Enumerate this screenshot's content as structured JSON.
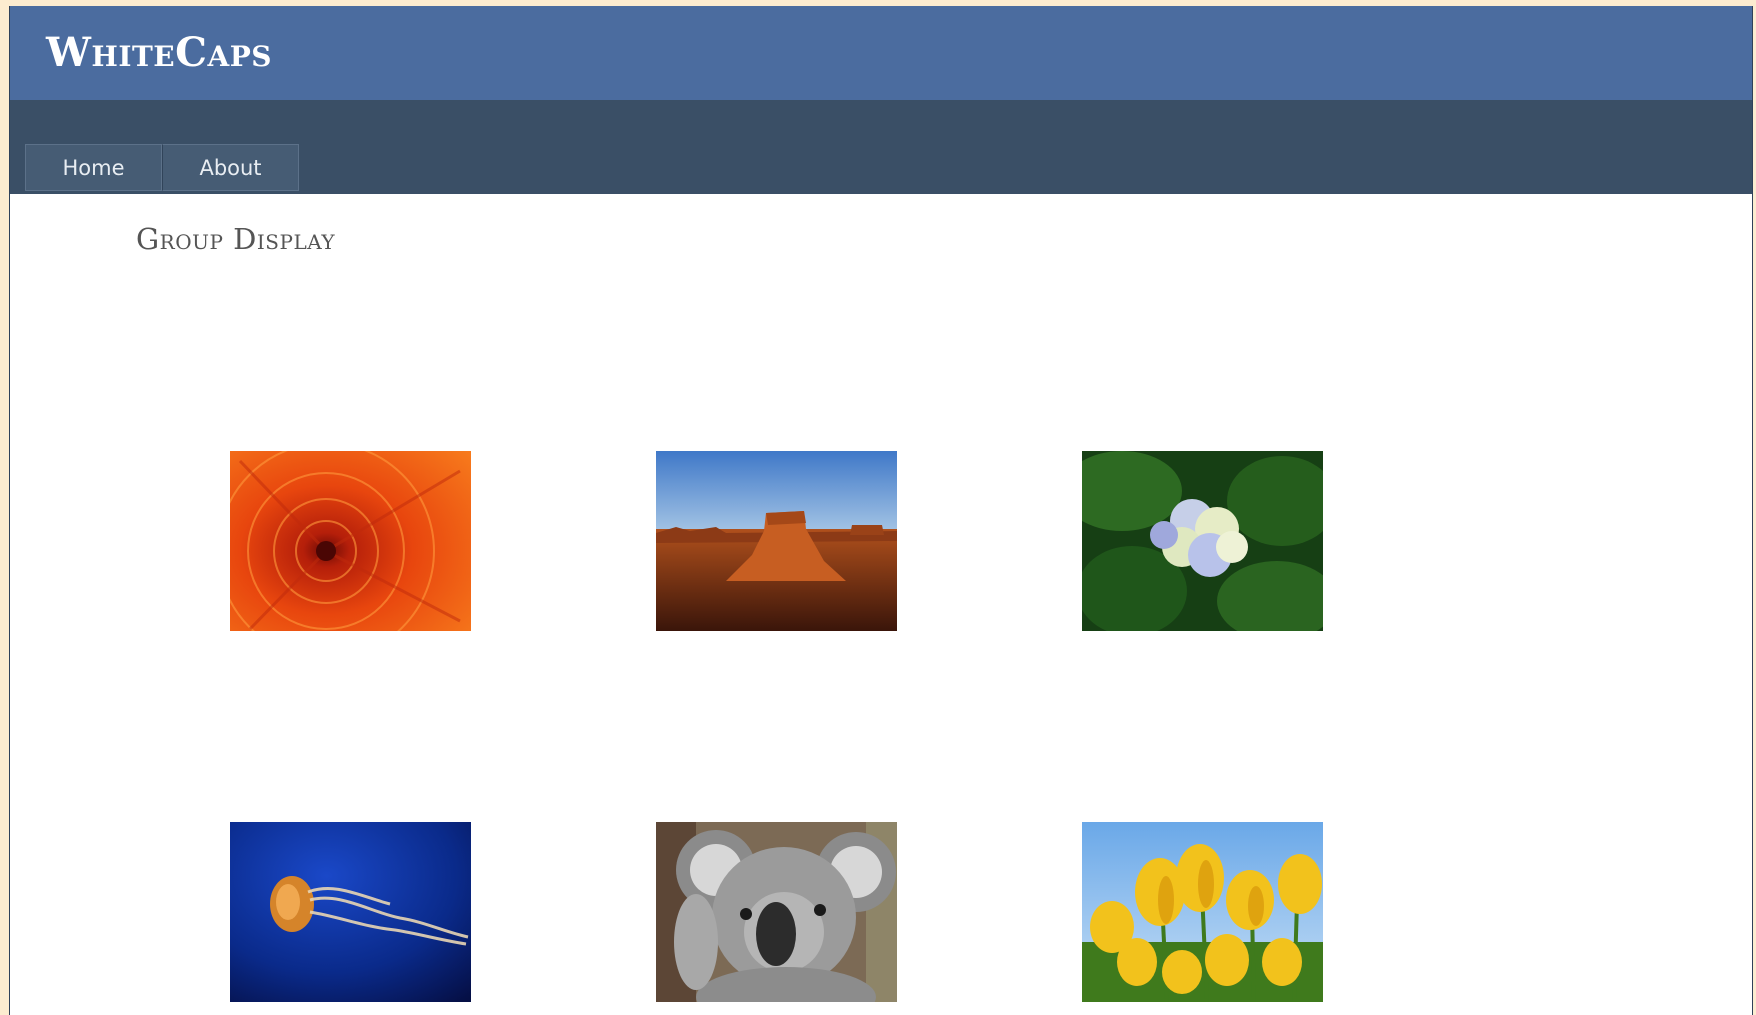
{
  "header": {
    "logo_text": "WhiteCaps"
  },
  "nav": {
    "items": [
      {
        "label": "Home"
      },
      {
        "label": "About"
      }
    ]
  },
  "main": {
    "title": "Group Display"
  },
  "gallery": {
    "images": [
      {
        "subject": "red-chrysanthemum"
      },
      {
        "subject": "desert-butte"
      },
      {
        "subject": "hydrangea"
      },
      {
        "subject": "jellyfish"
      },
      {
        "subject": "koala"
      },
      {
        "subject": "yellow-tulips"
      }
    ]
  },
  "colors": {
    "header_bg": "#4b6c9f",
    "nav_bg": "#3a4f66",
    "page_frame_bg": "#fcecd0"
  }
}
